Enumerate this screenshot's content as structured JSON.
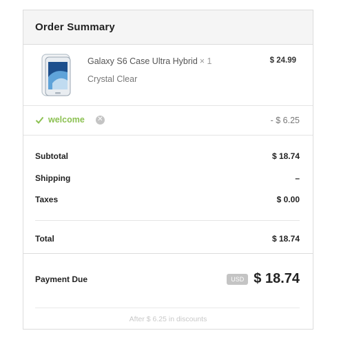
{
  "header": {
    "title": "Order Summary"
  },
  "item": {
    "name": "Galaxy S6 Case Ultra Hybrid",
    "quantity": "× 1",
    "variant": "Crystal Clear",
    "price": "$ 24.99",
    "image_icon": "phone-case-image"
  },
  "discount": {
    "code": "welcome",
    "amount": "- $ 6.25",
    "accent_color": "#8cc152"
  },
  "totals": {
    "subtotal_label": "Subtotal",
    "subtotal_value": "$ 18.74",
    "shipping_label": "Shipping",
    "shipping_value": "–",
    "taxes_label": "Taxes",
    "taxes_value": "$ 0.00",
    "total_label": "Total",
    "total_value": "$ 18.74"
  },
  "payment": {
    "label": "Payment Due",
    "currency": "USD",
    "amount": "$ 18.74",
    "note": "After $ 6.25 in discounts"
  }
}
